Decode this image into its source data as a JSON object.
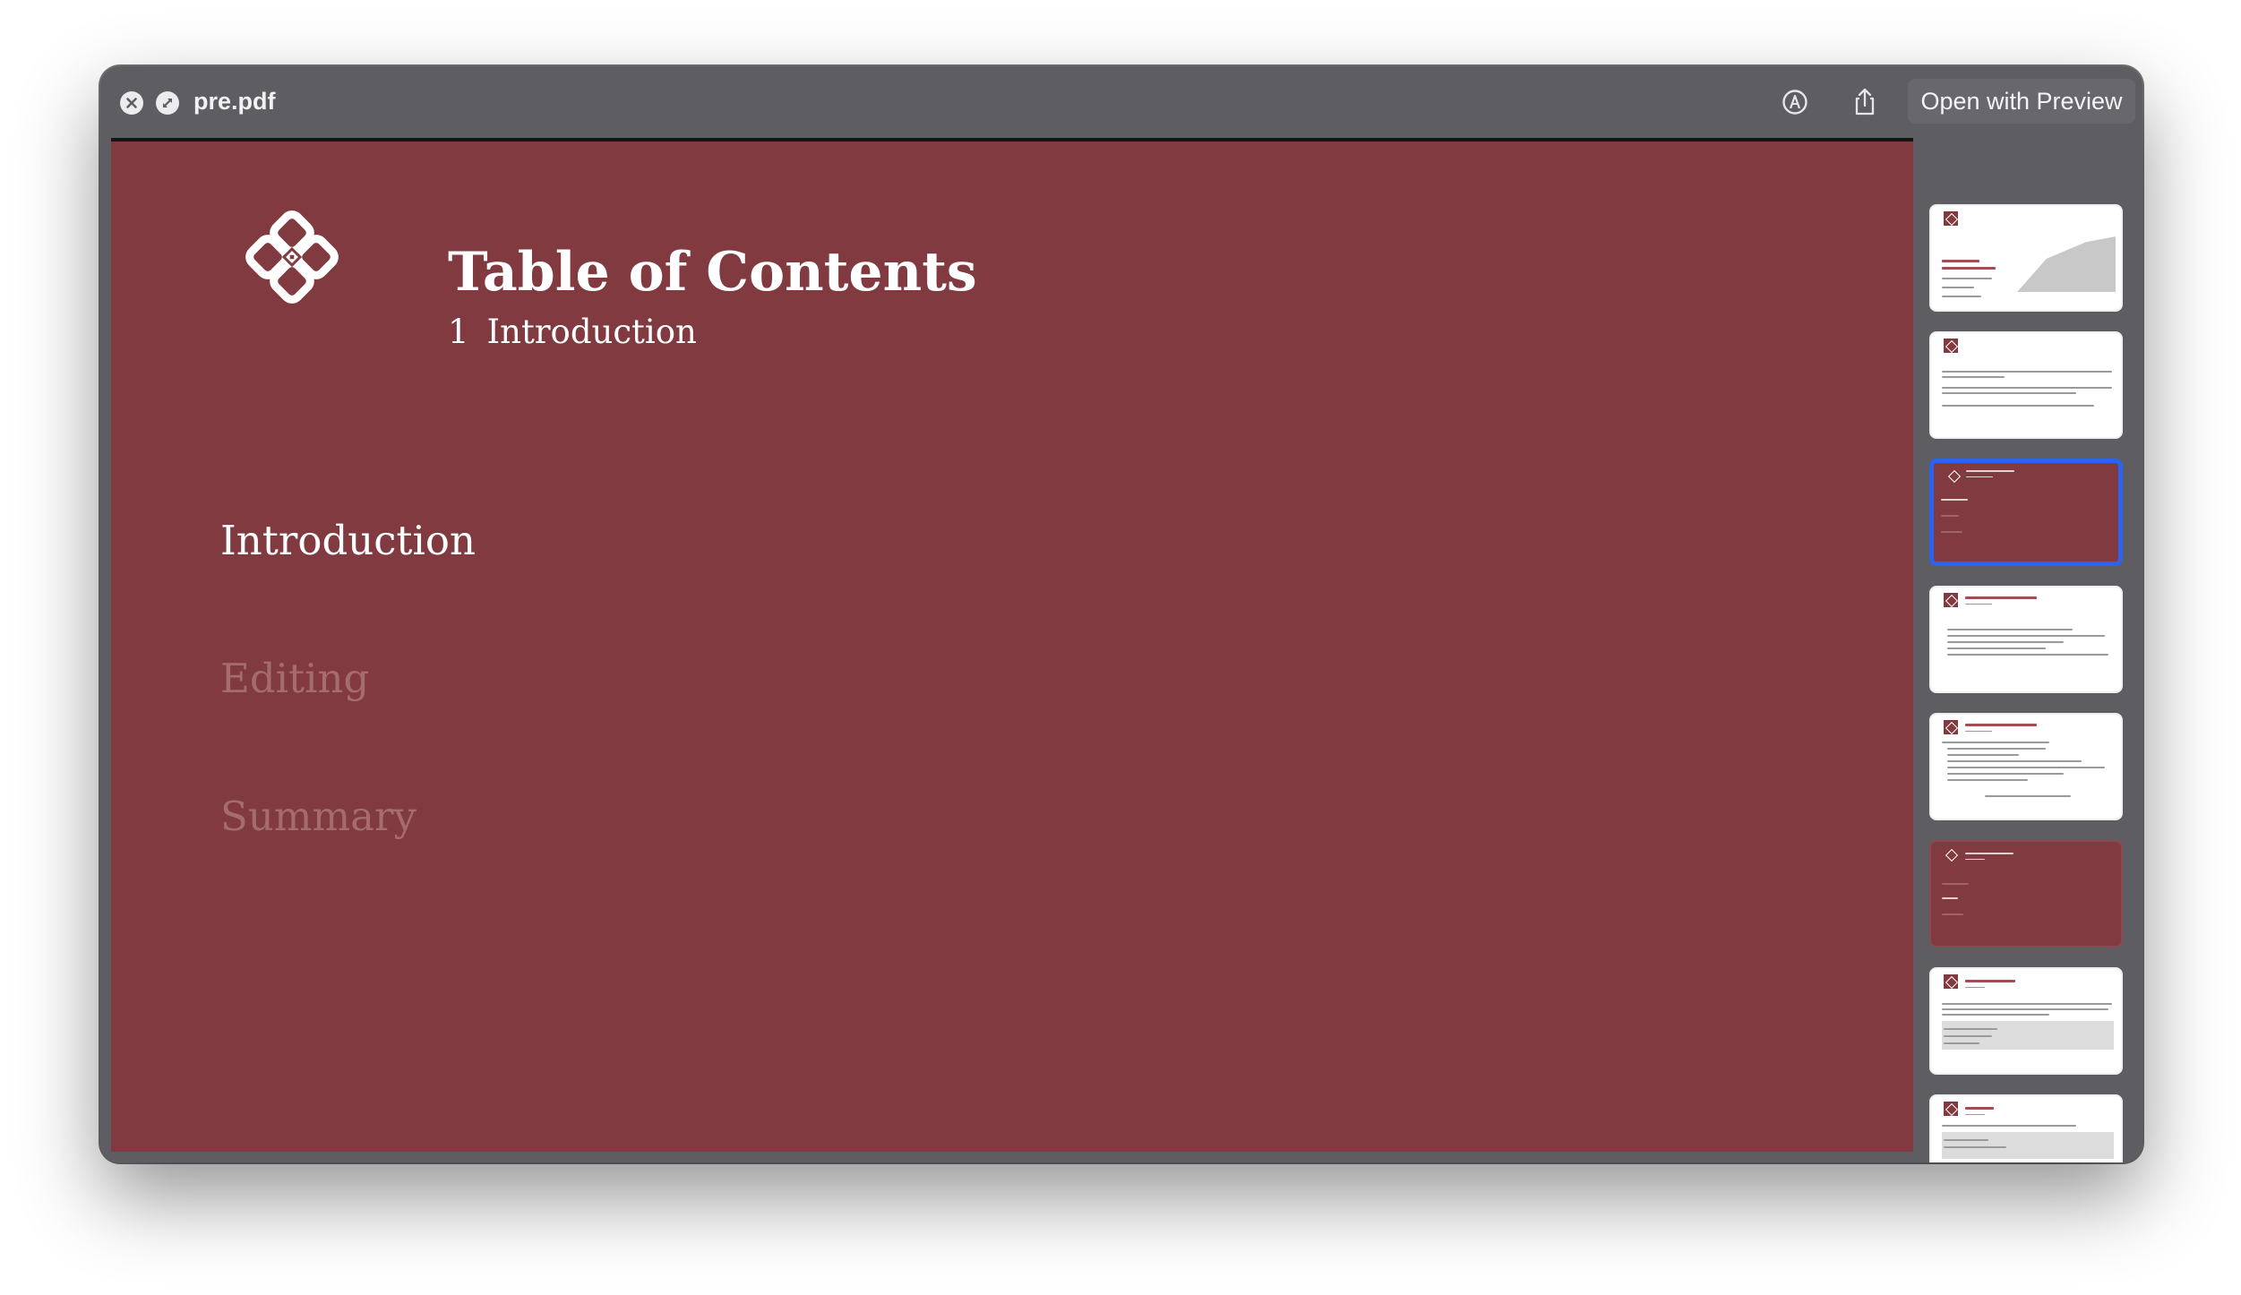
{
  "window": {
    "title": "pre.pdf",
    "open_with_label": "Open with Preview",
    "icons": [
      "close-icon",
      "fullscreen-icon",
      "markup-icon",
      "share-icon"
    ]
  },
  "slide": {
    "title": "Table of Contents",
    "subtitle_number": "1",
    "subtitle_text": "Introduction",
    "toc": [
      {
        "label": "Introduction",
        "state": "active"
      },
      {
        "label": "Editing",
        "state": "dimmed"
      },
      {
        "label": "Summary",
        "state": "dimmed"
      }
    ]
  },
  "thumbnails": [
    {
      "page": 1,
      "style": "light",
      "selected": false
    },
    {
      "page": 2,
      "style": "light",
      "selected": false
    },
    {
      "page": 3,
      "style": "dark",
      "selected": true
    },
    {
      "page": 4,
      "style": "light",
      "selected": false
    },
    {
      "page": 5,
      "style": "light",
      "selected": false
    },
    {
      "page": 6,
      "style": "dark",
      "selected": false
    },
    {
      "page": 7,
      "style": "light",
      "selected": false
    },
    {
      "page": 8,
      "style": "light",
      "selected": false
    }
  ],
  "colors": {
    "slide_background": "#813a3f",
    "window_chrome": "#5e5e62",
    "selection": "#2b62f0",
    "dimmed_text": "#a56c70"
  }
}
